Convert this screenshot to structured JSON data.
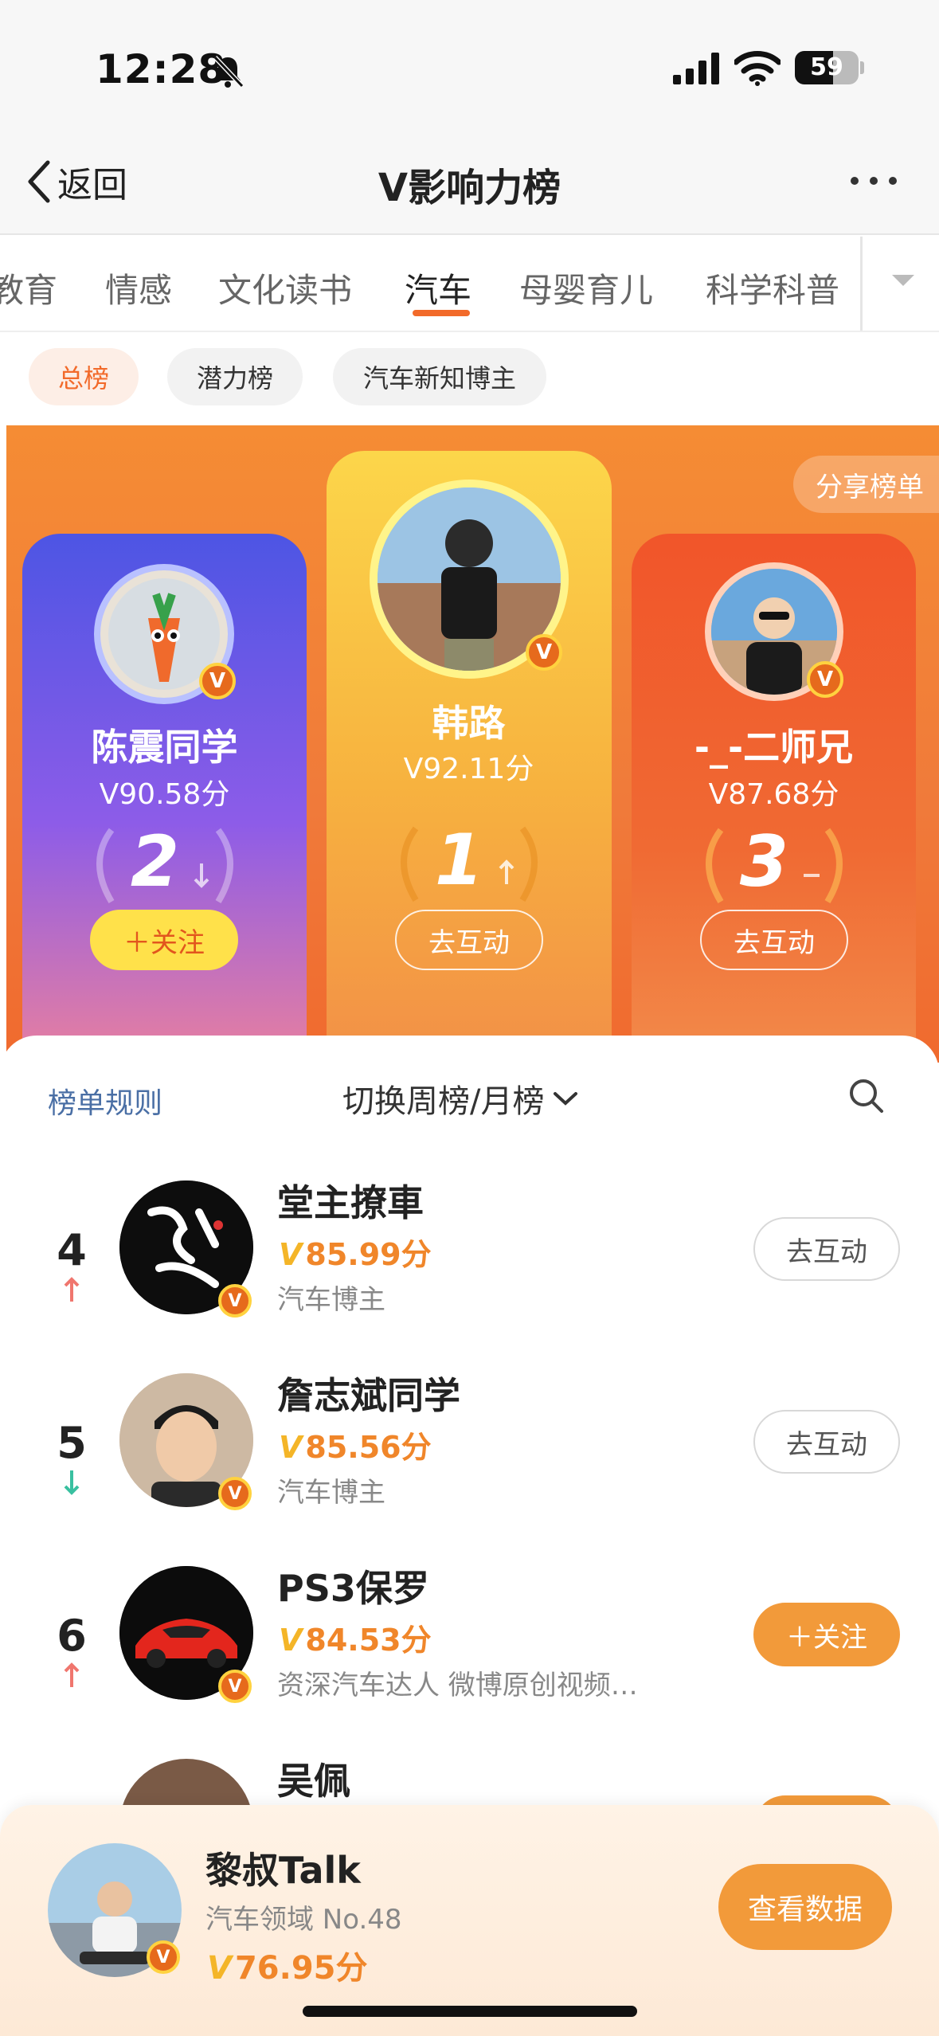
{
  "status": {
    "time": "12:28",
    "battery": "59"
  },
  "nav": {
    "back_label": "返回",
    "title": "V影响力榜"
  },
  "categories": [
    "教育",
    "情感",
    "文化读书",
    "汽车",
    "母婴育儿",
    "科学科普"
  ],
  "active_category": "汽车",
  "subtabs": [
    "总榜",
    "潜力榜",
    "汽车新知博主"
  ],
  "share_label": "分享榜单",
  "podium": [
    {
      "name": "陈震同学",
      "score": "V90.58分",
      "rank": "2",
      "trend": "down",
      "button": "＋关注"
    },
    {
      "name": "韩路",
      "score": "V92.11分",
      "rank": "1",
      "trend": "up",
      "button": "去互动"
    },
    {
      "name": "-_-二师兄",
      "score": "V87.68分",
      "rank": "3",
      "trend": "same",
      "button": "去互动"
    }
  ],
  "toolbar": {
    "rules": "榜单规则",
    "switch": "切换周榜/月榜"
  },
  "list": [
    {
      "rank": "4",
      "trend": "up",
      "name": "堂主撩車",
      "score": "85.99分",
      "desc": "汽车博主",
      "button": "去互动"
    },
    {
      "rank": "5",
      "trend": "down",
      "name": "詹志斌同学",
      "score": "85.56分",
      "desc": "汽车博主",
      "button": "去互动"
    },
    {
      "rank": "6",
      "trend": "up",
      "name": "PS3保罗",
      "score": "84.53分",
      "desc": "资深汽车达人 微博原创视频…",
      "button": "＋关注"
    },
    {
      "rank": "",
      "trend": "",
      "name": "吴佩",
      "score": "",
      "desc": "",
      "button": ""
    }
  ],
  "mine": {
    "name": "黎叔Talk",
    "rank_text": "汽车领域 No.48",
    "score": "76.95分",
    "button": "查看数据"
  },
  "colors": {
    "accent": "#f26a2a",
    "score": "#f0862a",
    "rule_link": "#4a6fa5"
  }
}
